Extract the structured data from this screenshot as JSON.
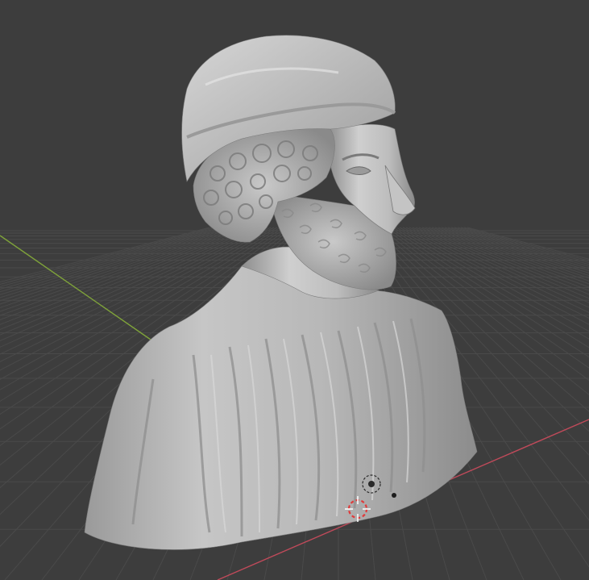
{
  "app": {
    "view": "3D Viewport",
    "shading": "solid"
  },
  "colors": {
    "background": "#3d3d3d",
    "grid_line": "#4a4a4a",
    "grid_line_major": "#515151",
    "x_axis": "#c04a5a",
    "y_axis": "#7fa33a",
    "mesh_light": "#d2d2d2",
    "mesh_mid": "#a8a8a8",
    "mesh_dark": "#6e6e6e",
    "cursor_red": "#e03a3a",
    "cursor_white": "#ffffff",
    "origin_dot": "#1c1c1c"
  },
  "scene": {
    "object": "bust-mesh",
    "icons": [
      "3d-cursor-icon",
      "object-origin-icon",
      "light-icon"
    ]
  }
}
